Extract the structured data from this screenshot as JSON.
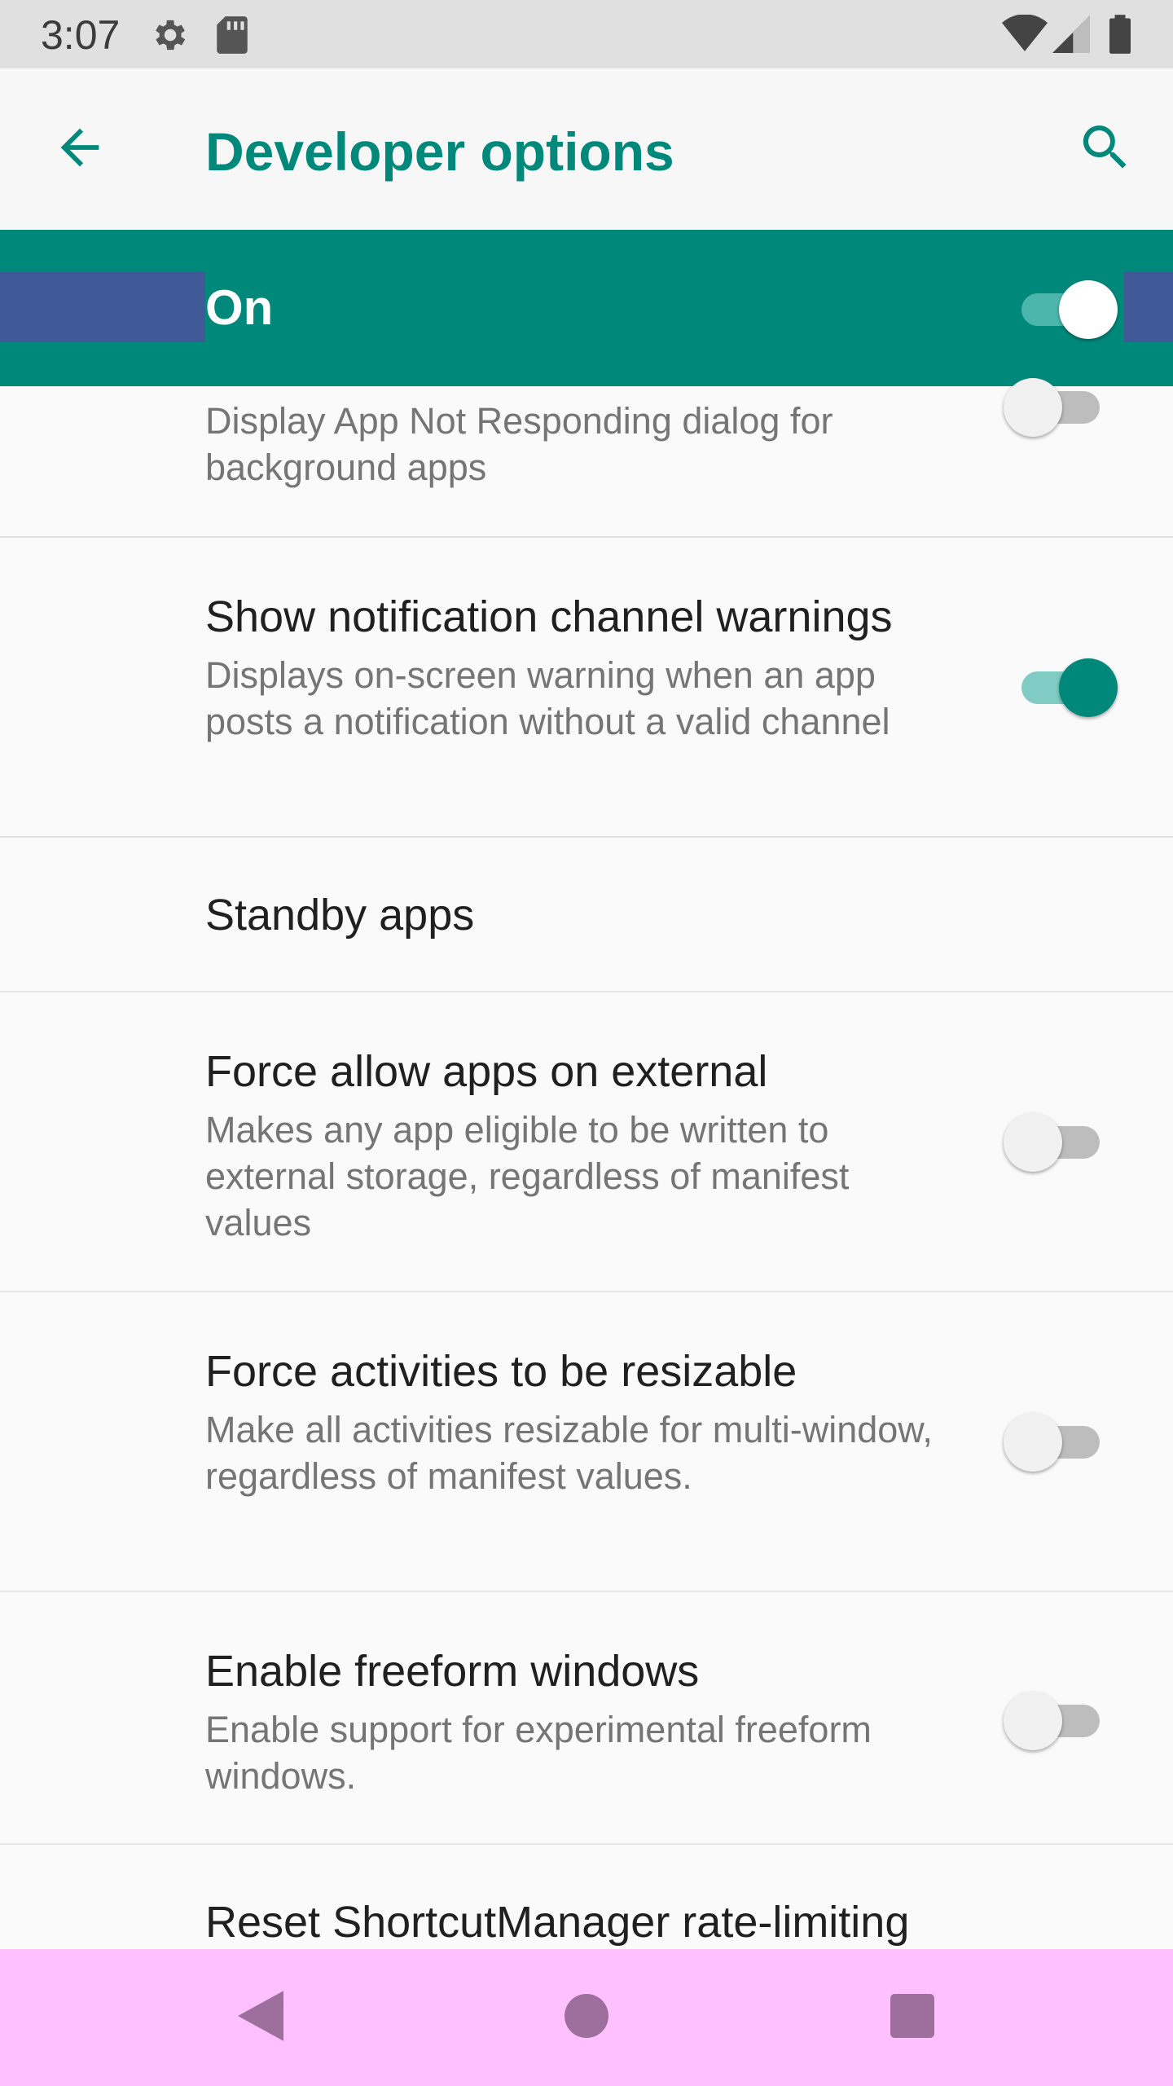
{
  "status_bar": {
    "time": "3:07",
    "icons": [
      "settings-icon",
      "sd-card-icon",
      "wifi-icon",
      "cell-signal-icon",
      "battery-icon"
    ]
  },
  "app_bar": {
    "title": "Developer options",
    "back_icon": "arrow-back-icon",
    "search_icon": "search-icon"
  },
  "master_switch": {
    "label": "On",
    "checked": true
  },
  "settings": [
    {
      "title": "",
      "summary": "Display App Not Responding dialog for background apps",
      "toggle": false
    },
    {
      "title": "Show notification channel warnings",
      "summary": "Displays on-screen warning when an app posts a notification without a valid channel",
      "toggle": true
    },
    {
      "title": "Standby apps",
      "summary": ""
    },
    {
      "title": "Force allow apps on external",
      "summary": "Makes any app eligible to be written to external storage, regardless of manifest values",
      "toggle": false
    },
    {
      "title": "Force activities to be resizable",
      "summary": "Make all activities resizable for multi-window, regardless of manifest values.",
      "toggle": false
    },
    {
      "title": "Enable freeform windows",
      "summary": "Enable support for experimental freeform windows.",
      "toggle": false
    },
    {
      "title": "Reset ShortcutManager rate-limiting",
      "summary": ""
    }
  ],
  "nav_bar": {
    "back_icon": "nav-back-icon",
    "home_icon": "nav-home-icon",
    "recents_icon": "nav-recents-icon"
  },
  "colors": {
    "accent": "#00897b",
    "nav_bar_bg": "#ffc0ff",
    "status_bar_bg": "#e0e0e0"
  }
}
